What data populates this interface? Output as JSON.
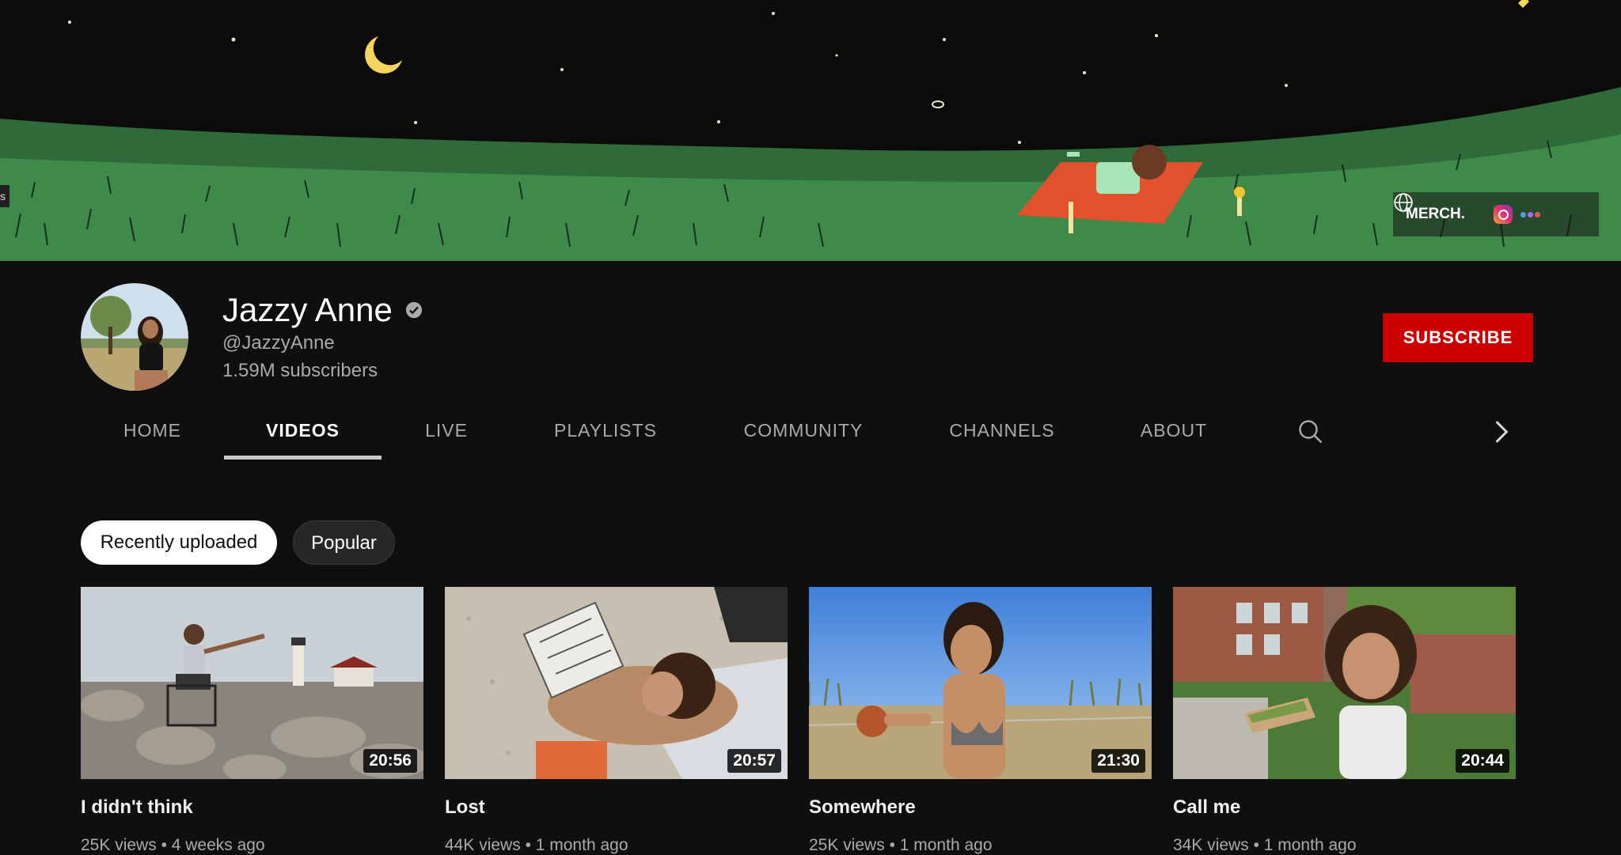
{
  "banner": {
    "side_tab_label": "s",
    "links": {
      "merch_label": "MERCH.",
      "globe_icon": "globe-icon",
      "instagram_icon": "instagram-icon",
      "more_icon": "more-links-icon"
    }
  },
  "channel": {
    "name": "Jazzy Anne",
    "handle": "@JazzyAnne",
    "subscribers": "1.59M subscribers",
    "subscribe_label": "SUBSCRIBE",
    "colors": {
      "subscribe": "#cc0000",
      "background": "#0f0f0f"
    }
  },
  "tabs": [
    {
      "label": "HOME",
      "active": false
    },
    {
      "label": "VIDEOS",
      "active": true
    },
    {
      "label": "LIVE",
      "active": false
    },
    {
      "label": "PLAYLISTS",
      "active": false
    },
    {
      "label": "COMMUNITY",
      "active": false
    },
    {
      "label": "CHANNELS",
      "active": false
    },
    {
      "label": "ABOUT",
      "active": false
    }
  ],
  "filters": [
    {
      "label": "Recently uploaded",
      "selected": true
    },
    {
      "label": "Popular",
      "selected": false
    }
  ],
  "videos": [
    {
      "title": "I didn't think",
      "duration": "20:56",
      "views": "25K views",
      "age": "4 weeks ago"
    },
    {
      "title": "Lost",
      "duration": "20:57",
      "views": "44K views",
      "age": "1 month ago"
    },
    {
      "title": "Somewhere",
      "duration": "21:30",
      "views": "25K views",
      "age": "1 month ago"
    },
    {
      "title": "Call me",
      "duration": "20:44",
      "views": "34K views",
      "age": "1 month ago"
    }
  ]
}
